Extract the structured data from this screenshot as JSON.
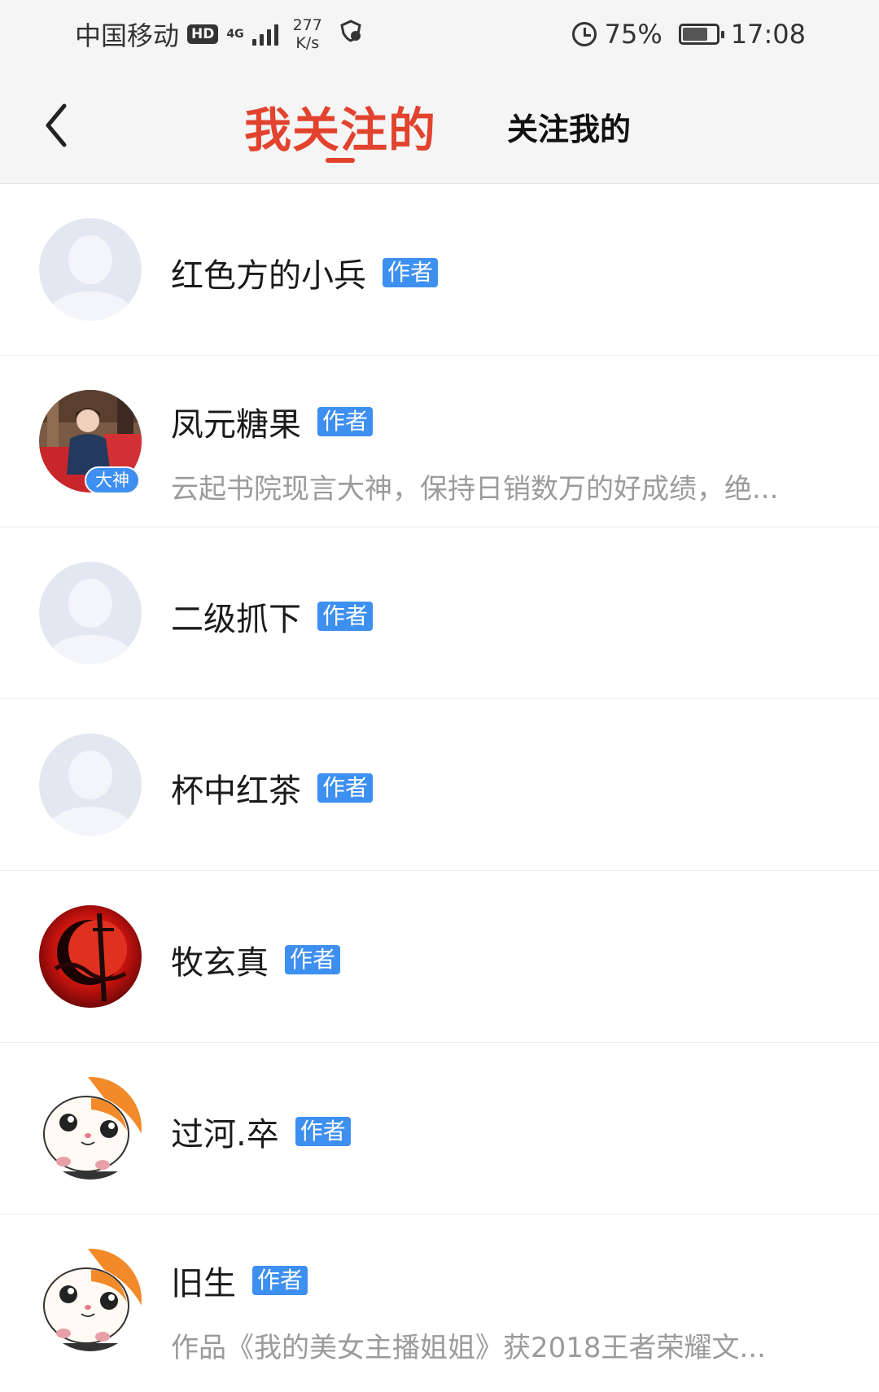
{
  "status_bar": {
    "carrier": "中国移动",
    "hd": "HD",
    "network": "4G",
    "speed_value": "277",
    "speed_unit": "K/s",
    "battery_percent": "75%",
    "battery_level": 0.75,
    "time": "17:08"
  },
  "header": {
    "back_icon": "chevron-left-icon",
    "tabs": [
      {
        "label": "我关注的",
        "active": true
      },
      {
        "label": "关注我的",
        "active": false
      }
    ]
  },
  "badge_label": "作者",
  "users": [
    {
      "name": "红色方的小兵",
      "badge": "作者",
      "desc": "",
      "avatar": "default-avatar"
    },
    {
      "name": "凤元糖果",
      "badge": "作者",
      "desc": "云起书院现言大神，保持日销数万的好成绩，绝...",
      "avatar": "photo-avatar",
      "avatar_badge": "大神"
    },
    {
      "name": "二级抓下",
      "badge": "作者",
      "desc": "",
      "avatar": "default-avatar"
    },
    {
      "name": "杯中红茶",
      "badge": "作者",
      "desc": "",
      "avatar": "default-avatar"
    },
    {
      "name": "牧玄真",
      "badge": "作者",
      "desc": "",
      "avatar": "red-moon-avatar"
    },
    {
      "name": "过河.卒",
      "badge": "作者",
      "desc": "",
      "avatar": "hamster-avatar"
    },
    {
      "name": "旧生",
      "badge": "作者",
      "desc": "作品《我的美女主播姐姐》获2018王者荣耀文...",
      "avatar": "hamster-avatar"
    }
  ],
  "colors": {
    "accent": "#e2432e",
    "badge_blue": "#3d8ff0",
    "header_bg": "#f5f5f5"
  }
}
